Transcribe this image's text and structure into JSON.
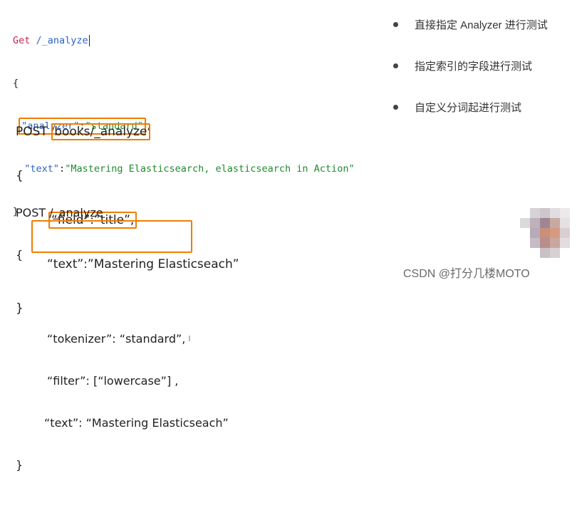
{
  "block1": {
    "method": "Get",
    "path": "/_analyze",
    "open_brace": "{",
    "analyzer_key": "\"analyzer\"",
    "colon": ":",
    "analyzer_value": "\"standard\"",
    "comma": ",",
    "text_key": "\"text\"",
    "text_value": "\"Mastering Elasticsearch, elasticsearch in Action\"",
    "close_brace": "}"
  },
  "block2": {
    "method": "POST",
    "path": "books/_analyze",
    "open_brace": "{",
    "field_line": "“field”:”title”,",
    "text_line": "“text”:”Mastering Elasticseach”",
    "close_brace": "}"
  },
  "block3": {
    "request_line": "POST /_analyze",
    "open_brace": "{",
    "tokenizer_line": "“tokenizer”: “standard”,",
    "filter_line": "“filter”: [“lowercase”] ,",
    "text_line": "“text”: “Mastering Elasticseach”",
    "close_brace": "}"
  },
  "bullets": [
    "直接指定 Analyzer 进行测试",
    "指定索引的字段进行测试",
    "自定义分词起进行测试"
  ],
  "watermark": "CSDN @打分几楼MOTO",
  "colors": {
    "highlight_box": "#f07c00",
    "json_key": "#2d62c8",
    "json_string": "#1e8b2e",
    "http_method": "#c7254e"
  }
}
